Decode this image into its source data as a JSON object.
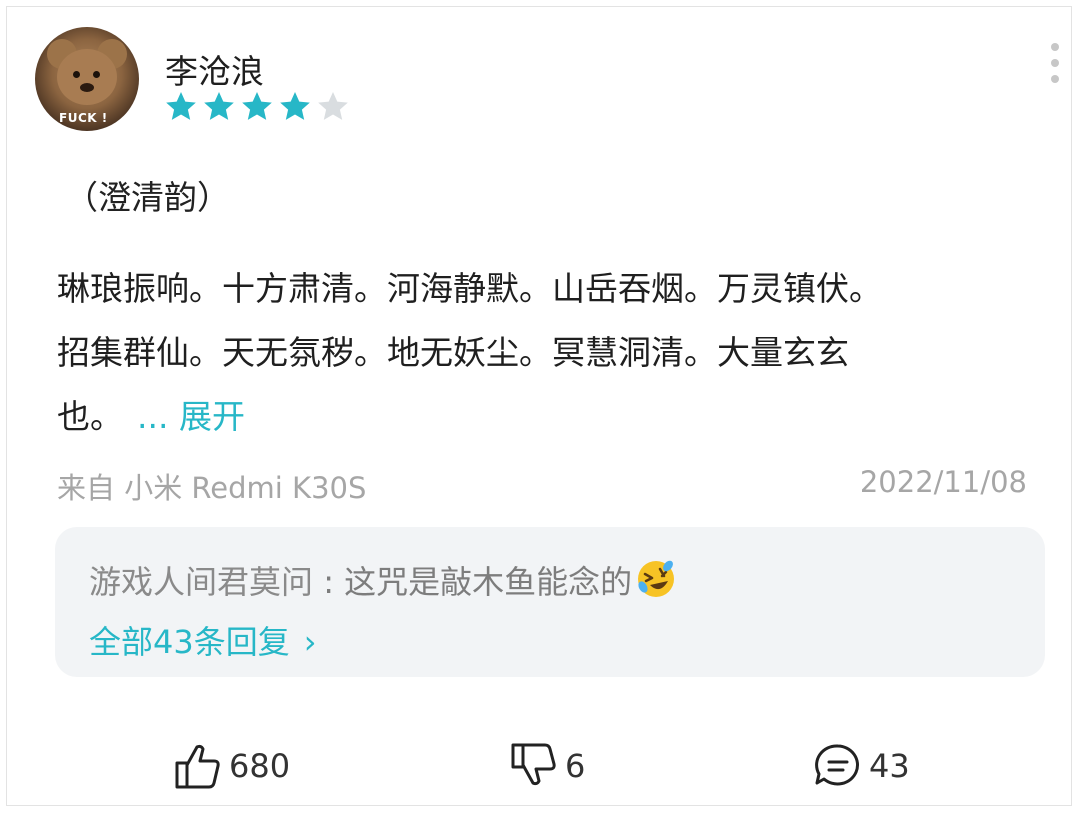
{
  "user": {
    "name": "李沧浪",
    "rating": 4,
    "max_rating": 5,
    "avatar_caption": "FUCK !"
  },
  "post": {
    "title": "（澄清韵）",
    "lines": [
      "琳琅振响。十方肃清。河海静默。山岳吞烟。万灵镇伏。",
      "招集群仙。天无氛秽。地无妖尘。冥慧洞清。大量玄玄",
      "也。"
    ],
    "expand_label": "... 展开",
    "source": "来自 小米 Redmi K30S",
    "date": "2022/11/08"
  },
  "reply": {
    "author": "游戏人间君莫问",
    "separator": " : ",
    "text": "这咒是敲木鱼能念的",
    "emoji": "rolling-on-floor-laughing-emoji",
    "all_replies_label": "全部43条回复",
    "chevron": "›"
  },
  "actions": {
    "likes": "680",
    "dislikes": "6",
    "comments": "43"
  },
  "colors": {
    "accent": "#27b7c7",
    "star_off": "#d9dde0",
    "muted": "#a6a6a6",
    "reply_bg": "#f2f4f6"
  }
}
